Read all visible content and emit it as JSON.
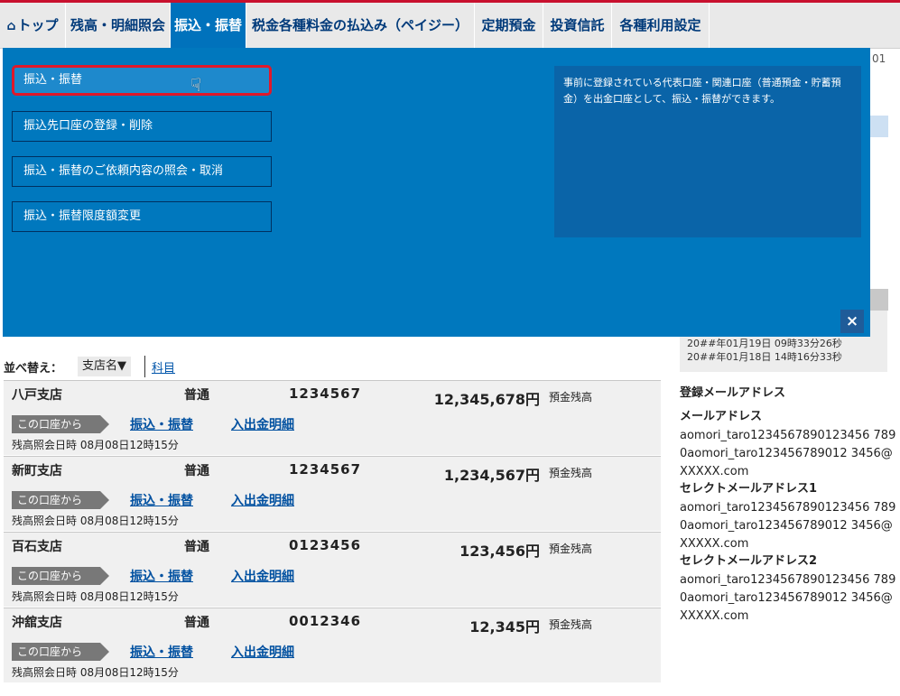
{
  "nav": {
    "items": [
      {
        "label": "トップ"
      },
      {
        "label": "残高・明細照会"
      },
      {
        "label": "振込・振替"
      },
      {
        "label": "税金各種料金の払込み（ペイジー）"
      },
      {
        "label": "定期預金"
      },
      {
        "label": "投資信託"
      },
      {
        "label": "各種利用設定"
      }
    ],
    "active_index": 2
  },
  "menu": {
    "items": [
      {
        "label": "振込・振替"
      },
      {
        "label": "振込先口座の登録・削除"
      },
      {
        "label": "振込・振替のご依頼内容の照会・取消"
      },
      {
        "label": "振込・振替限度額変更"
      }
    ],
    "description": "事前に登録されている代表口座・関連口座（普通預金・貯蓄預金）を出金口座として、振込・振替ができます。",
    "close": "×"
  },
  "right": {
    "edge_number": "01",
    "login_times": [
      "20##年01月19日 09時33分26秒",
      "20##年01月18日 14時16分33秒"
    ],
    "email_section_title": "登録メールアドレス",
    "emails": [
      {
        "label": "メールアドレス",
        "value": "aomori_taro1234567890123456 7890aomori_taro123456789012 3456@XXXXX.com"
      },
      {
        "label": "セレクトメールアドレス1",
        "value": "aomori_taro1234567890123456 7890aomori_taro123456789012 3456@XXXXX.com"
      },
      {
        "label": "セレクトメールアドレス2",
        "value": "aomori_taro1234567890123456 7890aomori_taro123456789012 3456@XXXXX.com"
      }
    ]
  },
  "sort": {
    "label": "並べ替え：",
    "branch": "支店名▼",
    "subject": "科目"
  },
  "accounts": [
    {
      "branch": "八戸支店",
      "type": "普通",
      "number": "1234567",
      "amount": "12,345,678円",
      "balance_label": "預金残高",
      "from_tag": "この口座から",
      "link_transfer": "振込・振替",
      "link_detail": "入出金明細",
      "time": "残高照会日時 08月08日12時15分"
    },
    {
      "branch": "新町支店",
      "type": "普通",
      "number": "1234567",
      "amount": "1,234,567円",
      "balance_label": "預金残高",
      "from_tag": "この口座から",
      "link_transfer": "振込・振替",
      "link_detail": "入出金明細",
      "time": "残高照会日時 08月08日12時15分"
    },
    {
      "branch": "百石支店",
      "type": "普通",
      "number": "0123456",
      "amount": "123,456円",
      "balance_label": "預金残高",
      "from_tag": "この口座から",
      "link_transfer": "振込・振替",
      "link_detail": "入出金明細",
      "time": "残高照会日時 08月08日12時15分"
    },
    {
      "branch": "沖舘支店",
      "type": "普通",
      "number": "0012346",
      "amount": "12,345円",
      "balance_label": "預金残高",
      "from_tag": "この口座から",
      "link_transfer": "振込・振替",
      "link_detail": "入出金明細",
      "time": "残高照会日時 08月08日12時15分"
    }
  ],
  "colors": {
    "nav_active": "#0072bc",
    "overlay": "#0078be",
    "highlight": "#e0182a",
    "link": "#0050a0"
  }
}
